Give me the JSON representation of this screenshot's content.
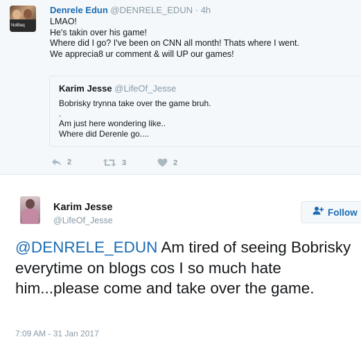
{
  "top_tweet": {
    "name": "Denrele Edun",
    "handle": "@DENRELE_EDUN",
    "dot": "·",
    "time": "4h",
    "avatar_text": "NoBlaq",
    "lines": [
      "LMAO!",
      "He's takin over his game!",
      "Where did I go? I've been on CNN all month! Thats where I went.",
      "We apprecia8 ur comment & will UP our games!"
    ],
    "quote": {
      "name": "Karim Jesse",
      "handle": "@LifeOf_Jesse",
      "lines": [
        "Bobrisky trynna take over the game bruh.",
        ".",
        "Am just here wondering like..",
        "Where did Derenle go...."
      ]
    },
    "actions": {
      "reply_count": "2",
      "retweet_count": "3",
      "like_count": "2"
    }
  },
  "main_tweet": {
    "name": "Karim Jesse",
    "handle": "@LifeOf_Jesse",
    "follow_label": "Follow",
    "mention": "@DENRELE_EDUN",
    "text": " Am tired of seeing Bobrisky everytime on blogs cos I so much hate him...please come and take over the game.",
    "timestamp": "7:09 AM - 31 Jan 2017"
  },
  "colors": {
    "accent": "#1b6bb3",
    "muted": "#8899a6",
    "icon": "#aab8c2",
    "quoted_bg": "#f5f8fa"
  },
  "icons": {
    "reply": "reply-icon",
    "retweet": "retweet-icon",
    "like": "heart-icon",
    "follow": "add-user-icon"
  }
}
